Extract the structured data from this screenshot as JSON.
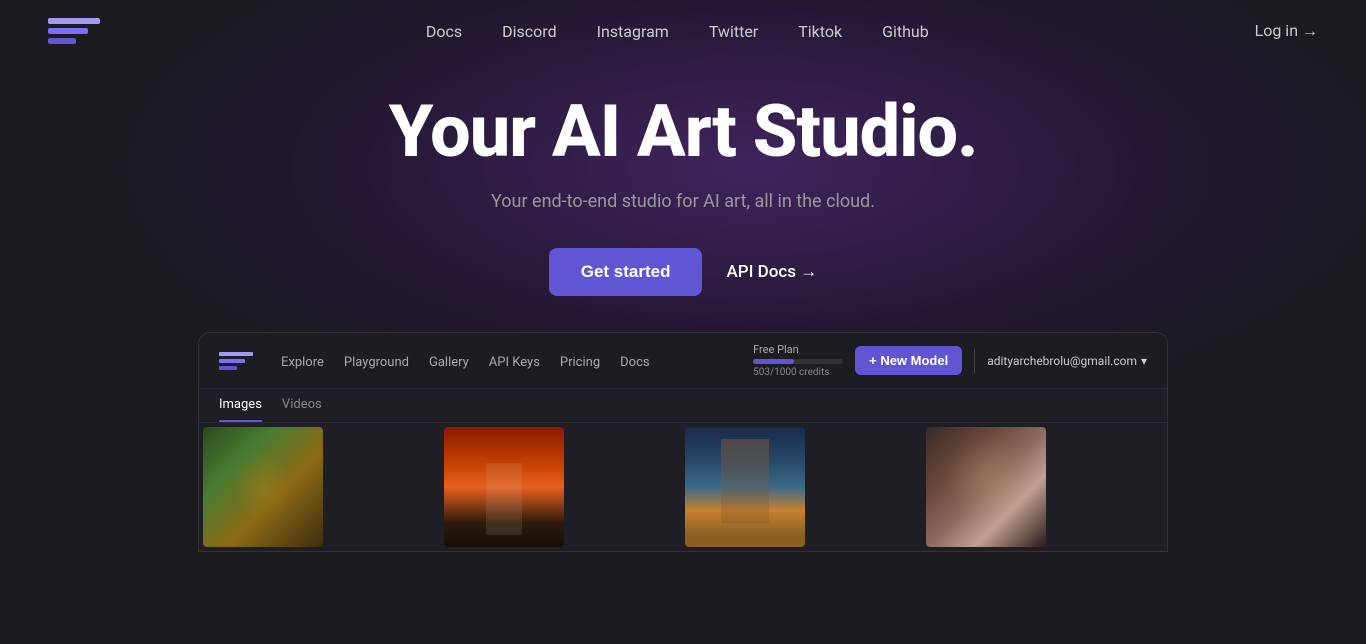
{
  "nav": {
    "links": [
      {
        "id": "docs",
        "label": "Docs"
      },
      {
        "id": "discord",
        "label": "Discord"
      },
      {
        "id": "instagram",
        "label": "Instagram"
      },
      {
        "id": "twitter",
        "label": "Twitter"
      },
      {
        "id": "tiktok",
        "label": "Tiktok"
      },
      {
        "id": "github",
        "label": "Github"
      }
    ],
    "login": "Log in →"
  },
  "hero": {
    "title": "Your AI Art Studio.",
    "subtitle": "Your end-to-end studio for AI art, all in the cloud.",
    "cta_primary": "Get started",
    "cta_secondary": "API Docs →"
  },
  "app_preview": {
    "nav_links": [
      {
        "id": "explore",
        "label": "Explore"
      },
      {
        "id": "playground",
        "label": "Playground"
      },
      {
        "id": "gallery",
        "label": "Gallery"
      },
      {
        "id": "api_keys",
        "label": "API Keys"
      },
      {
        "id": "pricing",
        "label": "Pricing"
      },
      {
        "id": "docs",
        "label": "Docs"
      }
    ],
    "plan": "Free Plan",
    "credits_used": "503",
    "credits_total": "1000",
    "credits_label": "503/1000 credits",
    "new_model_button": "+ New Model",
    "user_email": "adityarchebrolu@gmail.com",
    "tabs": [
      {
        "id": "images",
        "label": "Images",
        "active": true
      },
      {
        "id": "videos",
        "label": "Videos",
        "active": false
      }
    ],
    "gallery_images": [
      {
        "id": "img1",
        "alt": "Fantasy nature scene"
      },
      {
        "id": "img2",
        "alt": "Astronaut in desert"
      },
      {
        "id": "img3",
        "alt": "Sci-fi tower by sea"
      },
      {
        "id": "img4",
        "alt": "Portrait of woman"
      }
    ]
  },
  "colors": {
    "accent": "#6056d4",
    "accent_light": "#a09af5",
    "bg_dark": "#1a1a1f",
    "bg_nav": "#1c1c22"
  }
}
